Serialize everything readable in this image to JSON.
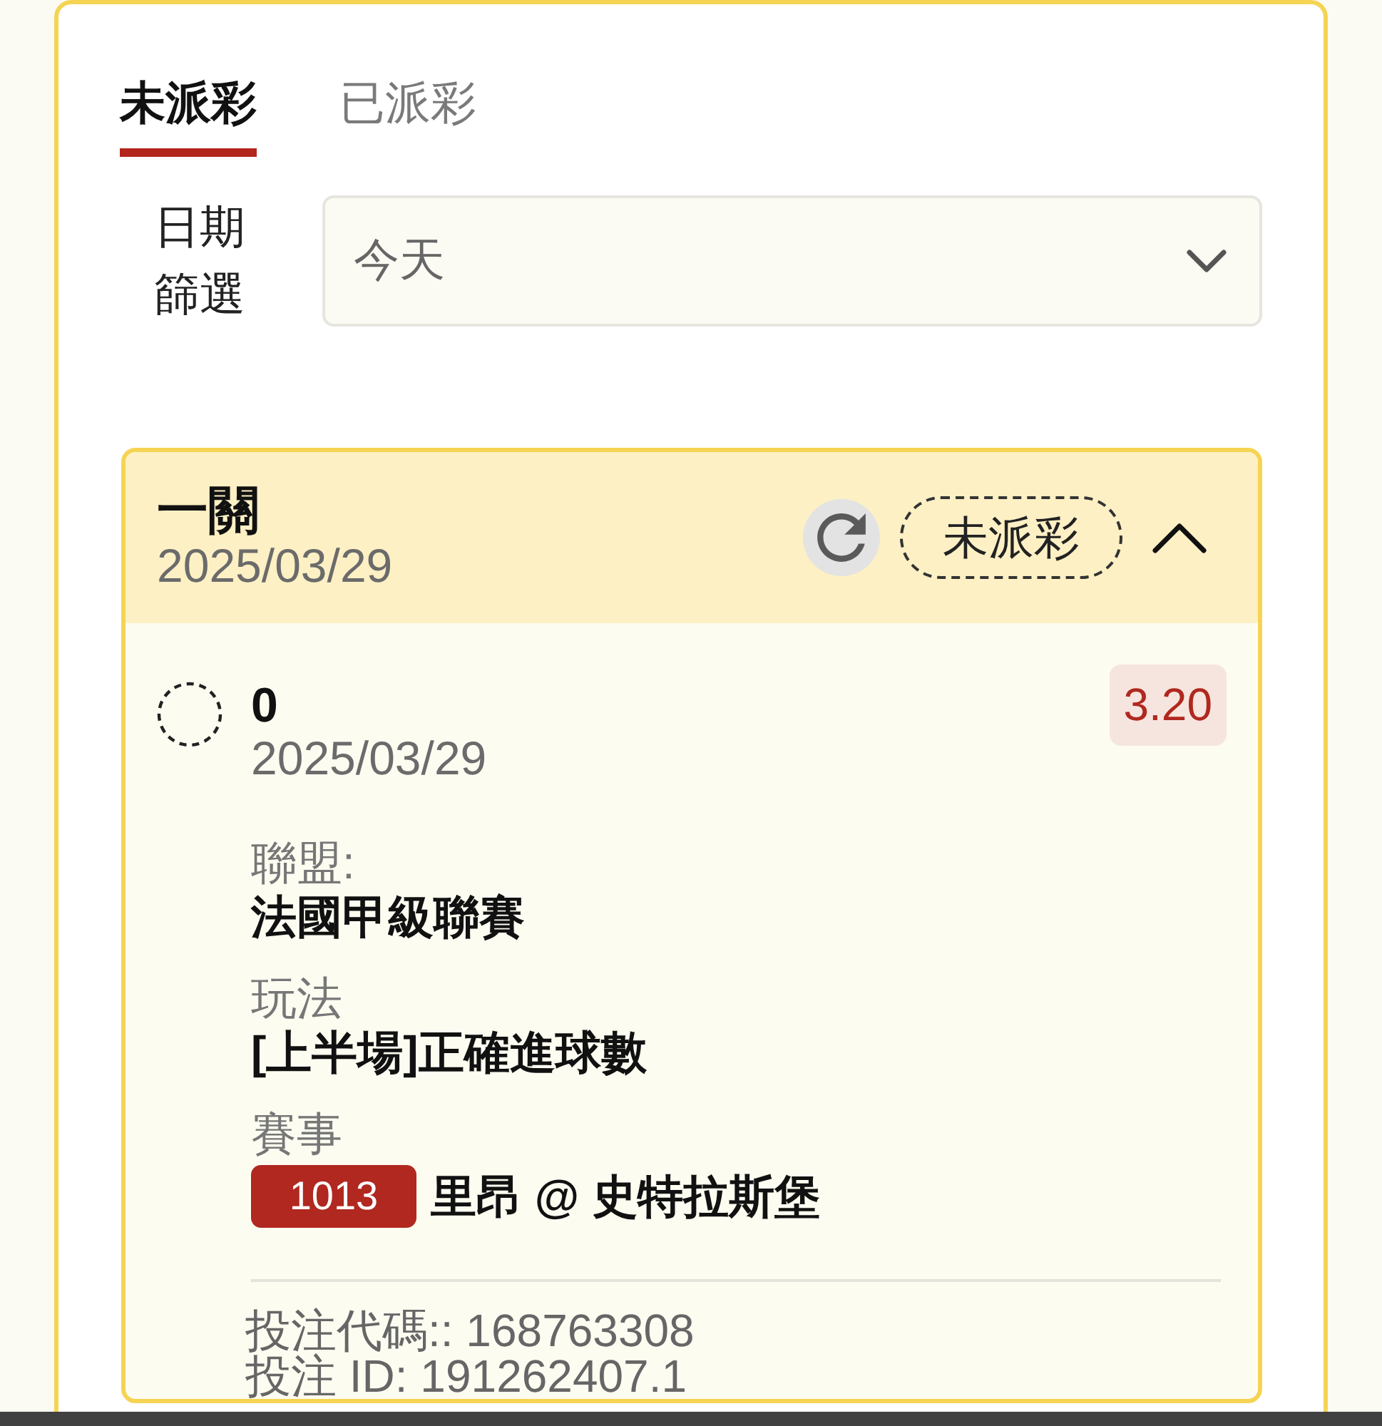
{
  "tabs": [
    {
      "label": "未派彩",
      "selected": true
    },
    {
      "label": "已派彩",
      "selected": false
    }
  ],
  "date_filter": {
    "label": "日期篩選",
    "value": "今天"
  },
  "bet_card": {
    "title": "一關",
    "date": "2025/03/29",
    "status": "未派彩",
    "expanded": true,
    "selections": [
      {
        "pick": "0",
        "date": "2025/03/29",
        "odds": "3.20",
        "fields": [
          {
            "kind": "text",
            "label": "聯盟:",
            "value": "法國甲級聯賽"
          },
          {
            "kind": "text",
            "label": "玩法",
            "value": "[上半場]正確進球數"
          },
          {
            "kind": "match",
            "label": "賽事",
            "match_no": "1013",
            "value": "里昂 @ 史特拉斯堡"
          }
        ]
      }
    ],
    "bet_code": "投注代碼:: 168763308",
    "bet_id": "投注 ID: 191262407.1"
  }
}
